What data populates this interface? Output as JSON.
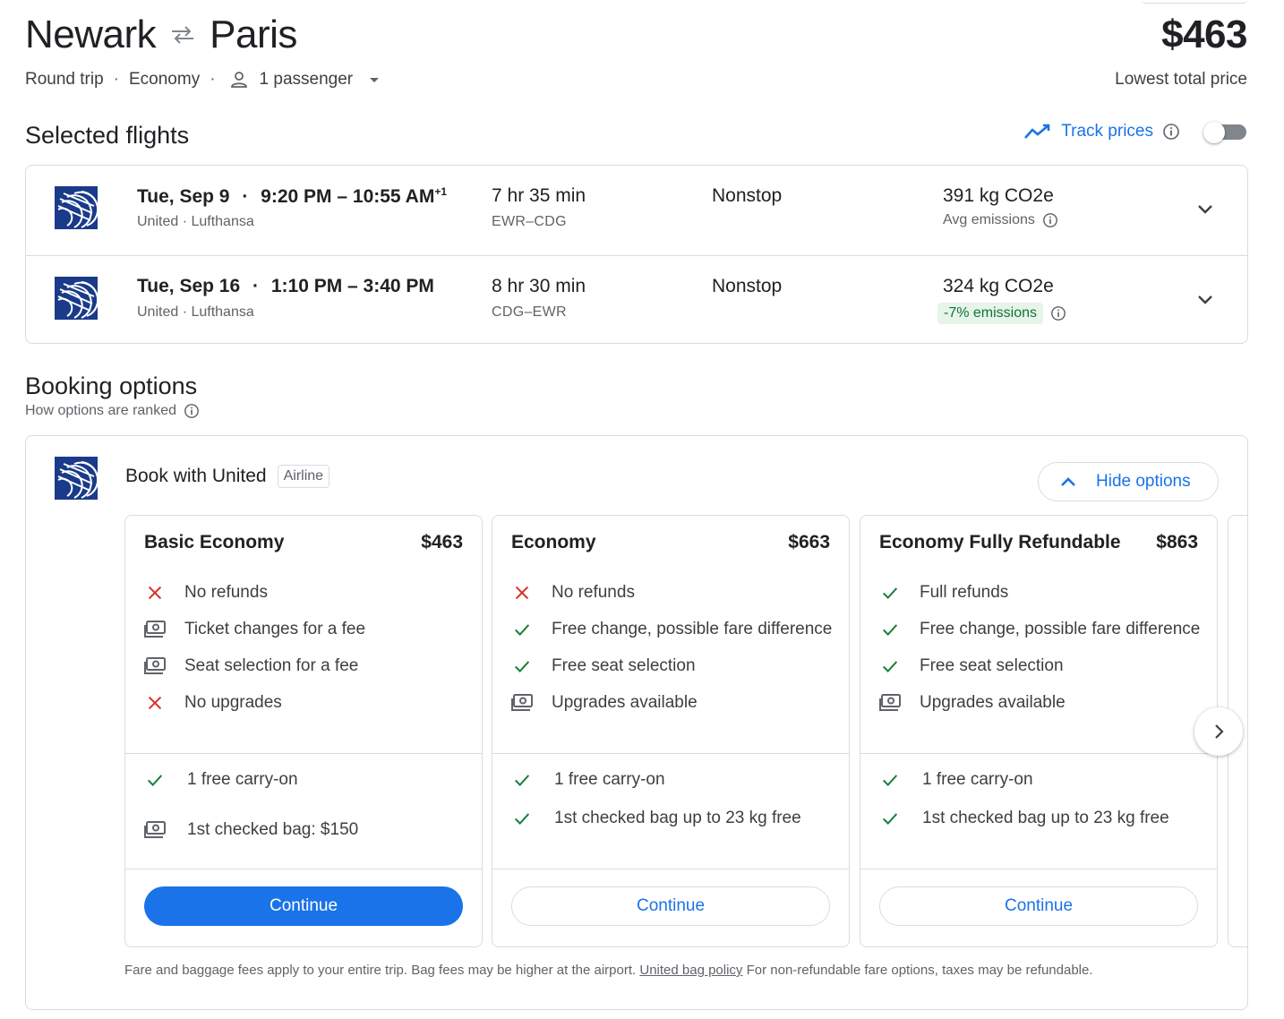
{
  "header": {
    "origin": "Newark",
    "destination": "Paris",
    "price": "$463",
    "price_caption": "Lowest total price",
    "trip_type": "Round trip",
    "cabin": "Economy",
    "passengers": "1 passenger"
  },
  "selected": {
    "title": "Selected flights",
    "track_label": "Track prices",
    "track_enabled": false,
    "flights": [
      {
        "date": "Tue, Sep 9",
        "times": "9:20 PM – 10:55 AM",
        "day_offset": "+1",
        "airlines": "United · Lufthansa",
        "duration": "7 hr 35 min",
        "airports": "EWR–CDG",
        "stops": "Nonstop",
        "emissions": "391 kg CO2e",
        "emissions_note": "Avg emissions"
      },
      {
        "date": "Tue, Sep 16",
        "times": "1:10 PM – 3:40 PM",
        "day_offset": "",
        "airlines": "United · Lufthansa",
        "duration": "8 hr 30 min",
        "airports": "CDG–EWR",
        "stops": "Nonstop",
        "emissions": "324 kg CO2e",
        "emissions_note": "-7% emissions"
      }
    ]
  },
  "booking": {
    "title": "Booking options",
    "ranked_label": "How options are ranked",
    "provider": "Book with United",
    "provider_tag": "Airline",
    "hide_label": "Hide options",
    "fares": [
      {
        "name": "Basic Economy",
        "price": "$463",
        "features": [
          {
            "icon": "x",
            "text": "No refunds"
          },
          {
            "icon": "fee",
            "text": "Ticket changes for a fee"
          },
          {
            "icon": "fee",
            "text": "Seat selection for a fee"
          },
          {
            "icon": "x",
            "text": "No upgrades"
          }
        ],
        "bags": [
          {
            "icon": "check",
            "text": "1 free carry-on"
          },
          {
            "icon": "fee",
            "text": "1st checked bag: $150"
          }
        ],
        "cta": "Continue"
      },
      {
        "name": "Economy",
        "price": "$663",
        "features": [
          {
            "icon": "x",
            "text": "No refunds"
          },
          {
            "icon": "check",
            "text": "Free change, possible fare difference"
          },
          {
            "icon": "check",
            "text": "Free seat selection"
          },
          {
            "icon": "fee",
            "text": "Upgrades available"
          }
        ],
        "bags": [
          {
            "icon": "check",
            "text": "1 free carry-on"
          },
          {
            "icon": "check",
            "text": "1st checked bag up to 23 kg free"
          }
        ],
        "cta": "Continue"
      },
      {
        "name": "Economy Fully Refundable",
        "price": "$863",
        "features": [
          {
            "icon": "check",
            "text": "Full refunds"
          },
          {
            "icon": "check",
            "text": "Free change, possible fare difference"
          },
          {
            "icon": "check",
            "text": "Free seat selection"
          },
          {
            "icon": "fee",
            "text": "Upgrades available"
          }
        ],
        "bags": [
          {
            "icon": "check",
            "text": "1 free carry-on"
          },
          {
            "icon": "check",
            "text": "1st checked bag up to 23 kg free"
          }
        ],
        "cta": "Continue"
      }
    ],
    "footnote_before": "Fare and baggage fees apply to your entire trip. Bag fees may be higher at the airport.",
    "footnote_link": "United bag policy",
    "footnote_after": "For non-refundable fare options, taxes may be refundable."
  },
  "colors": {
    "accent": "#1a73e8",
    "check": "#188038",
    "cross": "#d93025",
    "united_blue": "#1a3a8a",
    "eco_badge_bg": "#e6f4ea",
    "eco_badge_text": "#137333"
  }
}
